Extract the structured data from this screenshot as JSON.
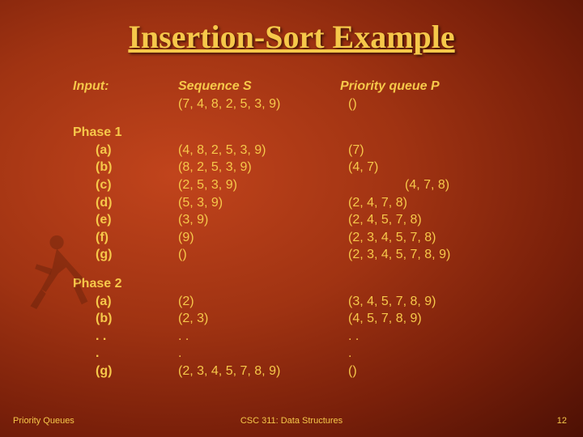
{
  "title": "Insertion-Sort Example",
  "headers": {
    "input": "Input:",
    "sequence": "Sequence S",
    "priority_queue": "Priority queue P"
  },
  "input_row": {
    "seq": "(7, 4, 8, 2, 5, 3, 9)",
    "pq": "()"
  },
  "phase1_label": "Phase 1",
  "phase1": [
    {
      "step": "(a)",
      "seq": "(4, 8, 2, 5, 3, 9)",
      "pq": "(7)"
    },
    {
      "step": "(b)",
      "seq": "(8, 2, 5, 3, 9)",
      "pq": "(4, 7)"
    },
    {
      "step": "(c)",
      "seq": "(2, 5, 3, 9)",
      "pq": "(4, 7, 8)"
    },
    {
      "step": "(d)",
      "seq": "(5, 3, 9)",
      "pq": "(2, 4, 7, 8)"
    },
    {
      "step": "(e)",
      "seq": "(3, 9)",
      "pq": "(2, 4, 5, 7, 8)"
    },
    {
      "step": "(f)",
      "seq": "(9)",
      "pq": "(2, 3, 4, 5, 7, 8)"
    },
    {
      "step": "(g)",
      "seq": "()",
      "pq": "(2, 3, 4, 5, 7, 8, 9)"
    }
  ],
  "phase2_label": "Phase 2",
  "phase2": [
    {
      "step": "(a)",
      "seq": "(2)",
      "pq": "(3, 4, 5, 7, 8, 9)"
    },
    {
      "step": "(b)",
      "seq": "(2, 3)",
      "pq": "(4, 5, 7, 8, 9)"
    },
    {
      "step": ". .",
      "seq": ". .",
      "pq": ". ."
    },
    {
      "step": ".",
      "seq": ".",
      "pq": "."
    },
    {
      "step": "(g)",
      "seq": "(2, 3, 4, 5, 7, 8, 9)",
      "pq": "()"
    }
  ],
  "footer": {
    "left": "Priority Queues",
    "center": "CSC 311: Data Structures",
    "right": "12"
  }
}
